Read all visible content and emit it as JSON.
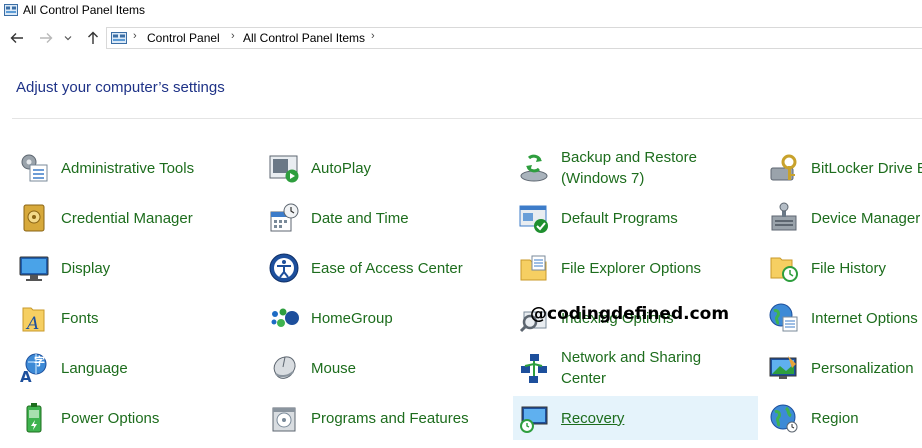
{
  "window": {
    "title": "All Control Panel Items"
  },
  "nav": {
    "back": "back",
    "forward": "forward",
    "recent": "recent",
    "up": "up"
  },
  "address": {
    "crumbs": [
      "Control Panel",
      "All Control Panel Items"
    ]
  },
  "heading": "Adjust your computer’s settings",
  "items": [
    {
      "label": "Administrative Tools",
      "icon": "administrative-tools-icon"
    },
    {
      "label": "AutoPlay",
      "icon": "autoplay-icon"
    },
    {
      "label": "Backup and Restore (Windows 7)",
      "icon": "backup-restore-icon"
    },
    {
      "label": "BitLocker Drive E",
      "icon": "bitlocker-icon"
    },
    {
      "label": "Credential Manager",
      "icon": "credential-manager-icon"
    },
    {
      "label": "Date and Time",
      "icon": "date-time-icon"
    },
    {
      "label": "Default Programs",
      "icon": "default-programs-icon"
    },
    {
      "label": "Device Manager",
      "icon": "device-manager-icon"
    },
    {
      "label": "Display",
      "icon": "display-icon"
    },
    {
      "label": "Ease of Access Center",
      "icon": "ease-of-access-icon"
    },
    {
      "label": "File Explorer Options",
      "icon": "file-explorer-options-icon"
    },
    {
      "label": "File History",
      "icon": "file-history-icon"
    },
    {
      "label": "Fonts",
      "icon": "fonts-icon"
    },
    {
      "label": "HomeGroup",
      "icon": "homegroup-icon"
    },
    {
      "label": "Indexing Options",
      "icon": "indexing-options-icon"
    },
    {
      "label": "Internet Options",
      "icon": "internet-options-icon"
    },
    {
      "label": "Language",
      "icon": "language-icon"
    },
    {
      "label": "Mouse",
      "icon": "mouse-icon"
    },
    {
      "label": "Network and Sharing Center",
      "icon": "network-sharing-icon"
    },
    {
      "label": "Personalization",
      "icon": "personalization-icon"
    },
    {
      "label": "Power Options",
      "icon": "power-options-icon"
    },
    {
      "label": "Programs and Features",
      "icon": "programs-features-icon"
    },
    {
      "label": "Recovery",
      "icon": "recovery-icon",
      "hovered": true
    },
    {
      "label": "Region",
      "icon": "region-icon"
    }
  ],
  "watermark": "@codingdefined.com",
  "colors": {
    "link": "#1d6d1d",
    "heading": "#1e3287",
    "hover_bg": "#e5f3fb"
  }
}
